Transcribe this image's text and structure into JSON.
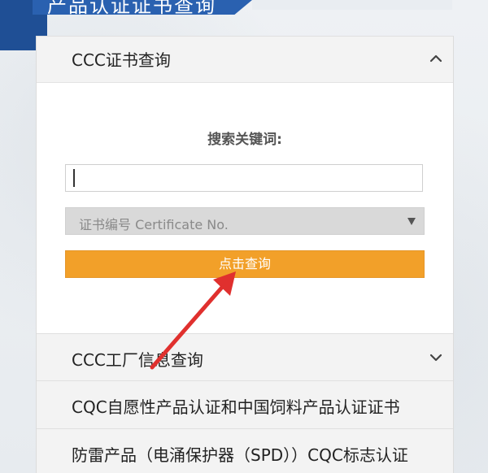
{
  "page": {
    "title": "产品认证证书查询"
  },
  "ccc_cert": {
    "header": "CCC证书查询",
    "keyword_label": "搜索关键词:",
    "keyword_value": "",
    "select_value": "证书编号 Certificate No.",
    "button_label": "点击查询"
  },
  "ccc_factory": {
    "header": "CCC工厂信息查询"
  },
  "cqc_voluntary": {
    "header": "CQC自愿性产品认证和中国饲料产品认证证书"
  },
  "lightning": {
    "header": "防雷产品（电涌保护器（SPD））CQC标志认证"
  },
  "colors": {
    "accent_blue": "#2a61b0",
    "button_orange": "#f2a029",
    "annotation_red": "#e0302e"
  },
  "icons": {
    "expanded": "chevron-up-icon",
    "collapsed": "chevron-down-icon"
  }
}
